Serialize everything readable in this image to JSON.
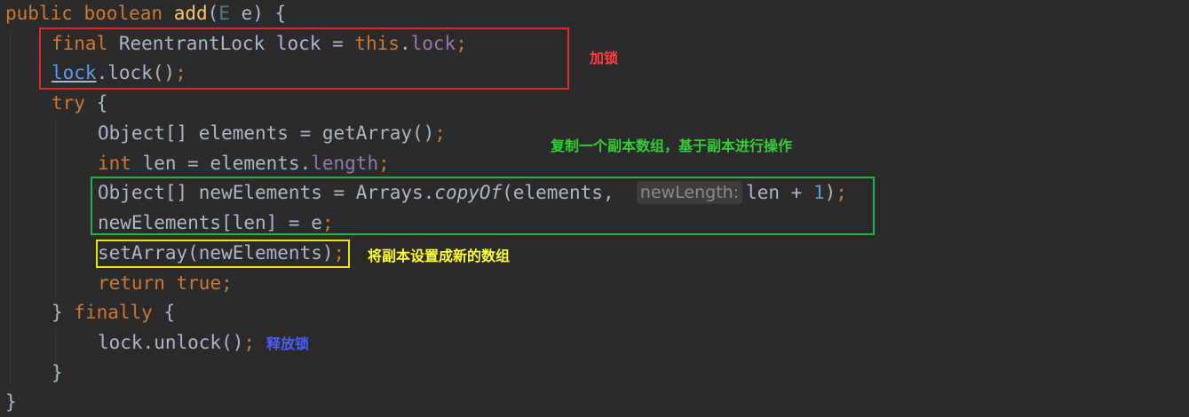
{
  "code": {
    "l1": {
      "public": "public",
      "boolean": "boolean",
      "method": "add",
      "open": "(",
      "type_param": "E",
      "rest": " e) {"
    },
    "l2": {
      "final": "final",
      "rest": " ReentrantLock lock = ",
      "this": "this",
      "dot": ".",
      "field": "lock",
      "semi": ";"
    },
    "l3": {
      "lock": "lock",
      "rest": ".lock()",
      "semi": ";"
    },
    "l4": {
      "try": "try",
      "rest": " {"
    },
    "l5": {
      "text": "Object[] elements = getArray()",
      "semi": ";"
    },
    "l6": {
      "int": "int",
      "rest": " len = elements.",
      "field": "length",
      "semi": ";"
    },
    "l7": {
      "pre": "Object[] newElements = Arrays.",
      "method": "copyOf",
      "args": "(elements,",
      "hint": "newLength:",
      "post": "len + ",
      "num": "1",
      "close": ")",
      "semi": ";"
    },
    "l8": {
      "text": "newElements[len] = e",
      "semi": ";"
    },
    "l9": {
      "text": "setArray(newElements)",
      "semi": ";"
    },
    "l10": {
      "return": "return",
      "true": "true",
      "semi": ";"
    },
    "l11": {
      "brace": "} ",
      "finally": "finally",
      "rest": " {"
    },
    "l12": {
      "text": "lock.unlock()",
      "semi": ";"
    },
    "l13": {
      "text": "}"
    },
    "l14": {
      "text": "}"
    }
  },
  "annotations": {
    "lock": {
      "text": "加锁",
      "color": "#ff3b3b"
    },
    "copy": {
      "text": "复制一个副本数组，基于副本进行操作",
      "color": "#33cc33"
    },
    "set": {
      "text": "将副本设置成新的数组",
      "color": "#ffff33"
    },
    "unlock": {
      "text": "释放锁",
      "color": "#4a5cff"
    }
  }
}
